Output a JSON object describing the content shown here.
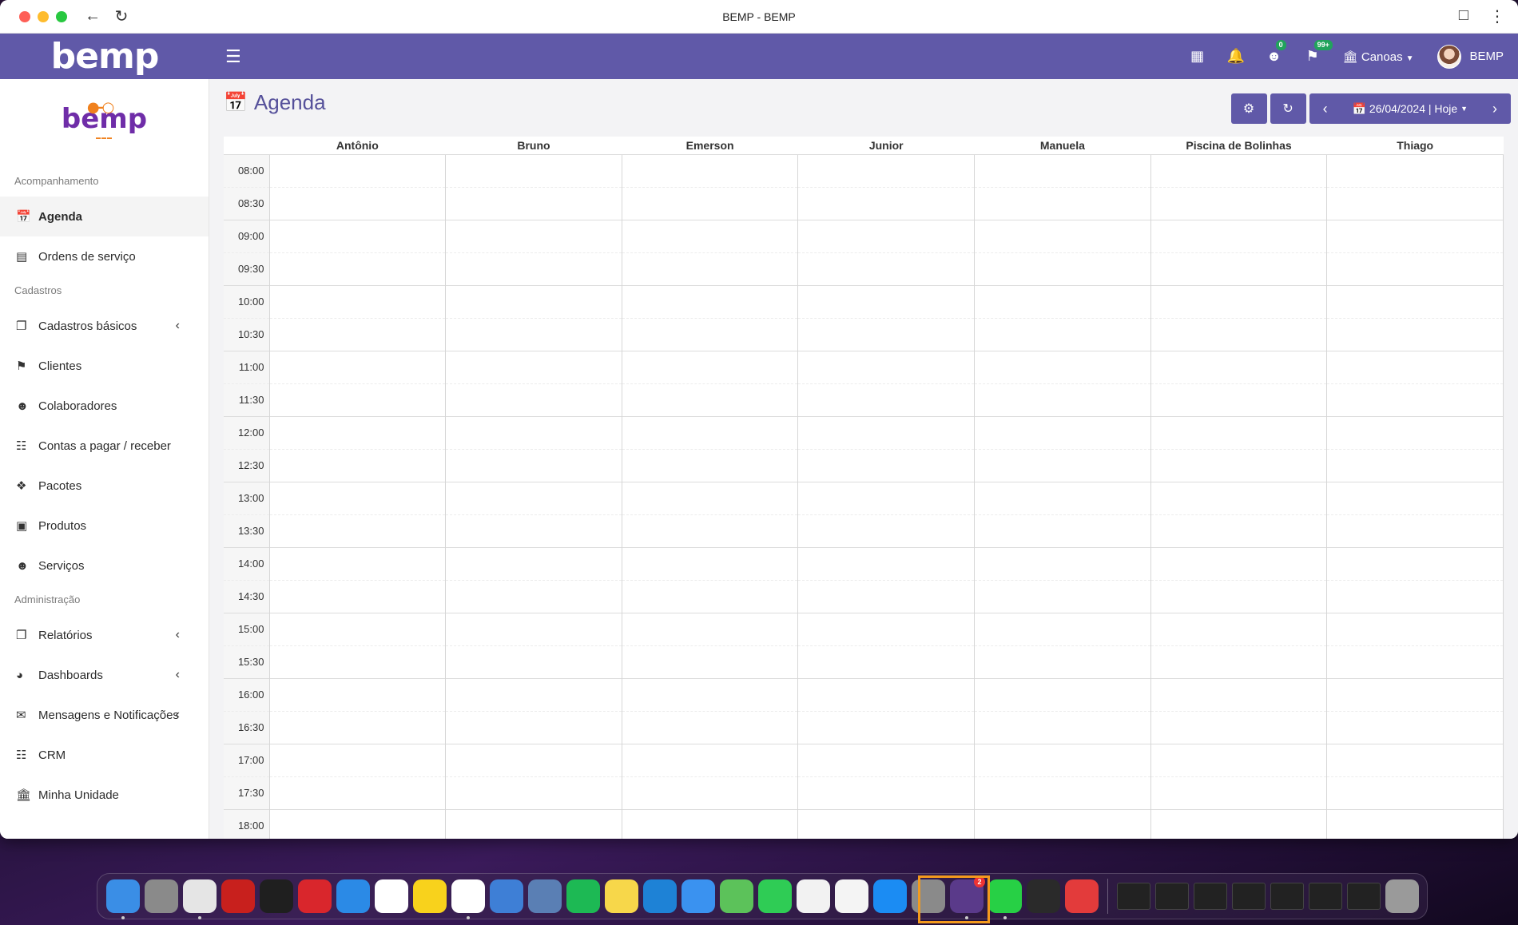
{
  "window": {
    "title": "BEMP - BEMP"
  },
  "header": {
    "logo": "bemp",
    "badges": {
      "users": "0",
      "bookmarks": "99+"
    },
    "unit": "Canoas",
    "user": "BEMP"
  },
  "sidebar": {
    "logo_text": "bemp",
    "sections": {
      "acompanhamento": "Acompanhamento",
      "cadastros": "Cadastros",
      "administracao": "Administração"
    },
    "items": {
      "agenda": "Agenda",
      "ordens": "Ordens de serviço",
      "cadastros_basicos": "Cadastros básicos",
      "clientes": "Clientes",
      "colaboradores": "Colaboradores",
      "contas": "Contas a pagar / receber",
      "pacotes": "Pacotes",
      "produtos": "Produtos",
      "servicos": "Serviços",
      "relatorios": "Relatórios",
      "dashboards": "Dashboards",
      "mensagens": "Mensagens e Notificações",
      "crm": "CRM",
      "minha_unidade": "Minha Unidade"
    }
  },
  "page": {
    "title": "Agenda",
    "date_label": "26/04/2024 | Hoje",
    "columns": [
      "Antônio",
      "Bruno",
      "Emerson",
      "Junior",
      "Manuela",
      "Piscina de Bolinhas",
      "Thiago"
    ],
    "times": [
      "08:00",
      "08:30",
      "09:00",
      "09:30",
      "10:00",
      "10:30",
      "11:00",
      "11:30",
      "12:00",
      "12:30",
      "13:00",
      "13:30",
      "14:00",
      "14:30",
      "15:00",
      "15:30",
      "16:00",
      "16:30",
      "17:00",
      "17:30",
      "18:00"
    ]
  },
  "dock": {
    "apps": [
      {
        "name": "finder-icon",
        "color": "#3a8ee6"
      },
      {
        "name": "launchpad-icon",
        "color": "#8a8a8a"
      },
      {
        "name": "chrome-icon",
        "color": "#e5e5e5"
      },
      {
        "name": "acrobat-icon",
        "color": "#c8201d"
      },
      {
        "name": "terminal-icon",
        "color": "#1f1f1f"
      },
      {
        "name": "dots-app-icon",
        "color": "#d9262c"
      },
      {
        "name": "safari-icon",
        "color": "#2b8ae6"
      },
      {
        "name": "notion-icon",
        "color": "#ffffff"
      },
      {
        "name": "miro-icon",
        "color": "#f8d21c"
      },
      {
        "name": "slack-icon",
        "color": "#ffffff"
      },
      {
        "name": "qb-icon",
        "color": "#3e7fd6"
      },
      {
        "name": "virtualbox-icon",
        "color": "#5a7fb4"
      },
      {
        "name": "spotify-icon",
        "color": "#1db954"
      },
      {
        "name": "notes-icon",
        "color": "#f7d74a"
      },
      {
        "name": "vscode-icon",
        "color": "#1e82d6"
      },
      {
        "name": "mail-icon",
        "color": "#3a92f0"
      },
      {
        "name": "maps-icon",
        "color": "#5cc25a"
      },
      {
        "name": "facetime-icon",
        "color": "#2fcc55"
      },
      {
        "name": "reminders-icon",
        "color": "#f2f2f2"
      },
      {
        "name": "photos-icon",
        "color": "#f4f4f4"
      },
      {
        "name": "app-store-icon",
        "color": "#1b8cf3"
      },
      {
        "name": "system-settings-icon",
        "color": "#8a8a8a"
      },
      {
        "name": "bemp-app-icon",
        "color": "#5a3a8a"
      },
      {
        "name": "whatsapp-icon",
        "color": "#27d045"
      },
      {
        "name": "quicktime-icon",
        "color": "#2a2a2a"
      },
      {
        "name": "wps-icon",
        "color": "#e33b3b"
      }
    ],
    "bemp_badge": "2"
  }
}
